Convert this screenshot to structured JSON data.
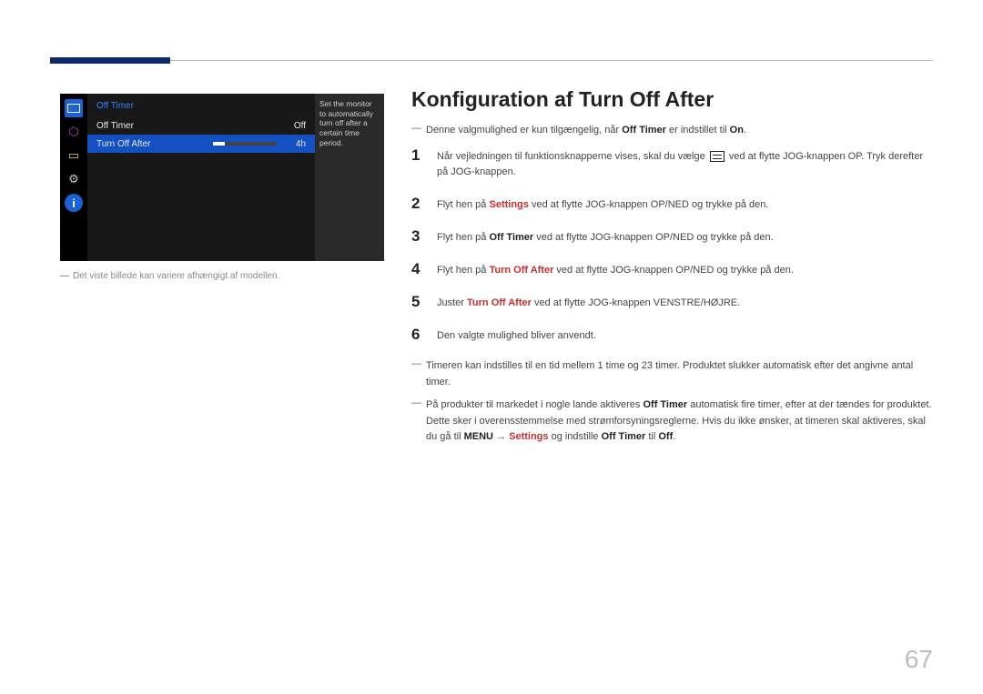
{
  "page_number": "67",
  "osd": {
    "title": "Off Timer",
    "rows": [
      {
        "label": "Off Timer",
        "value": "Off",
        "selected": false,
        "slider": false
      },
      {
        "label": "Turn Off After",
        "value": "4h",
        "selected": true,
        "slider": true
      }
    ],
    "help": "Set the monitor to automatically turn off after a certain time period."
  },
  "caption": "Det viste billede kan variere afhængigt af modellen.",
  "heading": "Konfiguration af Turn Off After",
  "intro_note": {
    "pre": "Denne valgmulighed er kun tilgængelig, når ",
    "bold1": "Off Timer",
    "mid": " er indstillet til ",
    "bold2": "On",
    "post": "."
  },
  "steps": [
    {
      "num": "1",
      "parts": [
        {
          "t": "Når vejledningen til funktionsknapperne vises, skal du vælge "
        },
        {
          "icon": true
        },
        {
          "t": " ved at flytte JOG-knappen OP. Tryk derefter på JOG-knappen."
        }
      ]
    },
    {
      "num": "2",
      "parts": [
        {
          "t": "Flyt hen på "
        },
        {
          "hl": "Settings"
        },
        {
          "t": " ved at flytte JOG-knappen OP/NED og trykke på den."
        }
      ]
    },
    {
      "num": "3",
      "parts": [
        {
          "t": "Flyt hen på "
        },
        {
          "b": "Off Timer"
        },
        {
          "t": " ved at flytte JOG-knappen OP/NED og trykke på den."
        }
      ]
    },
    {
      "num": "4",
      "parts": [
        {
          "t": "Flyt hen på "
        },
        {
          "hl": "Turn Off After"
        },
        {
          "t": " ved at flytte JOG-knappen OP/NED og trykke på den."
        }
      ]
    },
    {
      "num": "5",
      "parts": [
        {
          "t": "Juster "
        },
        {
          "hl": "Turn Off After"
        },
        {
          "t": " ved at flytte JOG-knappen VENSTRE/HØJRE."
        }
      ]
    },
    {
      "num": "6",
      "parts": [
        {
          "t": "Den valgte mulighed bliver anvendt."
        }
      ]
    }
  ],
  "footnotes": [
    {
      "parts": [
        {
          "t": "Timeren kan indstilles til en tid mellem 1 time og 23 timer. Produktet slukker automatisk efter det angivne antal timer."
        }
      ]
    },
    {
      "parts": [
        {
          "t": "På produkter til markedet i nogle lande aktiveres "
        },
        {
          "b": "Off Timer"
        },
        {
          "t": " automatisk fire timer, efter at der tændes for produktet. Dette sker i overensstemmelse med strømforsyningsreglerne. Hvis du ikke ønsker, at timeren skal aktiveres, skal du gå til "
        },
        {
          "b": "MENU"
        },
        {
          "t": " → "
        },
        {
          "hl": "Settings"
        },
        {
          "t": " og indstille "
        },
        {
          "b": "Off Timer"
        },
        {
          "t": " til "
        },
        {
          "b": "Off"
        },
        {
          "t": "."
        }
      ]
    }
  ]
}
